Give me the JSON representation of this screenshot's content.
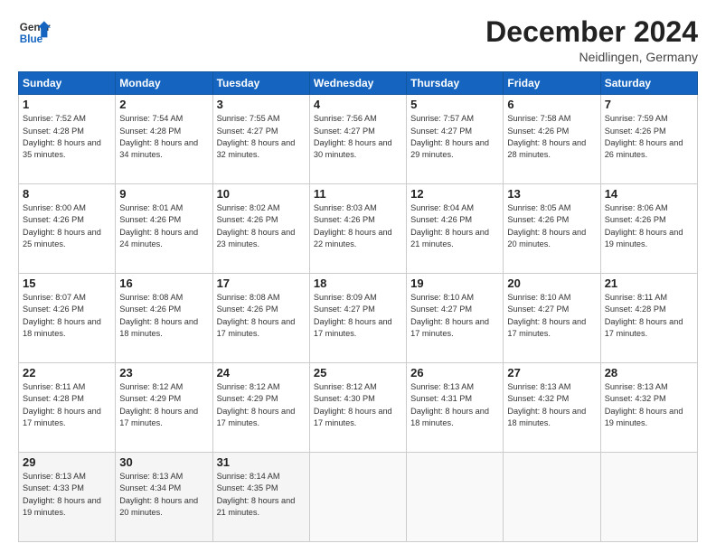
{
  "header": {
    "logo_line1": "General",
    "logo_line2": "Blue",
    "month": "December 2024",
    "location": "Neidlingen, Germany"
  },
  "weekdays": [
    "Sunday",
    "Monday",
    "Tuesday",
    "Wednesday",
    "Thursday",
    "Friday",
    "Saturday"
  ],
  "weeks": [
    [
      {
        "day": "1",
        "sunrise": "7:52 AM",
        "sunset": "4:28 PM",
        "daylight": "8 hours and 35 minutes."
      },
      {
        "day": "2",
        "sunrise": "7:54 AM",
        "sunset": "4:28 PM",
        "daylight": "8 hours and 34 minutes."
      },
      {
        "day": "3",
        "sunrise": "7:55 AM",
        "sunset": "4:27 PM",
        "daylight": "8 hours and 32 minutes."
      },
      {
        "day": "4",
        "sunrise": "7:56 AM",
        "sunset": "4:27 PM",
        "daylight": "8 hours and 30 minutes."
      },
      {
        "day": "5",
        "sunrise": "7:57 AM",
        "sunset": "4:27 PM",
        "daylight": "8 hours and 29 minutes."
      },
      {
        "day": "6",
        "sunrise": "7:58 AM",
        "sunset": "4:26 PM",
        "daylight": "8 hours and 28 minutes."
      },
      {
        "day": "7",
        "sunrise": "7:59 AM",
        "sunset": "4:26 PM",
        "daylight": "8 hours and 26 minutes."
      }
    ],
    [
      {
        "day": "8",
        "sunrise": "8:00 AM",
        "sunset": "4:26 PM",
        "daylight": "8 hours and 25 minutes."
      },
      {
        "day": "9",
        "sunrise": "8:01 AM",
        "sunset": "4:26 PM",
        "daylight": "8 hours and 24 minutes."
      },
      {
        "day": "10",
        "sunrise": "8:02 AM",
        "sunset": "4:26 PM",
        "daylight": "8 hours and 23 minutes."
      },
      {
        "day": "11",
        "sunrise": "8:03 AM",
        "sunset": "4:26 PM",
        "daylight": "8 hours and 22 minutes."
      },
      {
        "day": "12",
        "sunrise": "8:04 AM",
        "sunset": "4:26 PM",
        "daylight": "8 hours and 21 minutes."
      },
      {
        "day": "13",
        "sunrise": "8:05 AM",
        "sunset": "4:26 PM",
        "daylight": "8 hours and 20 minutes."
      },
      {
        "day": "14",
        "sunrise": "8:06 AM",
        "sunset": "4:26 PM",
        "daylight": "8 hours and 19 minutes."
      }
    ],
    [
      {
        "day": "15",
        "sunrise": "8:07 AM",
        "sunset": "4:26 PM",
        "daylight": "8 hours and 18 minutes."
      },
      {
        "day": "16",
        "sunrise": "8:08 AM",
        "sunset": "4:26 PM",
        "daylight": "8 hours and 18 minutes."
      },
      {
        "day": "17",
        "sunrise": "8:08 AM",
        "sunset": "4:26 PM",
        "daylight": "8 hours and 17 minutes."
      },
      {
        "day": "18",
        "sunrise": "8:09 AM",
        "sunset": "4:27 PM",
        "daylight": "8 hours and 17 minutes."
      },
      {
        "day": "19",
        "sunrise": "8:10 AM",
        "sunset": "4:27 PM",
        "daylight": "8 hours and 17 minutes."
      },
      {
        "day": "20",
        "sunrise": "8:10 AM",
        "sunset": "4:27 PM",
        "daylight": "8 hours and 17 minutes."
      },
      {
        "day": "21",
        "sunrise": "8:11 AM",
        "sunset": "4:28 PM",
        "daylight": "8 hours and 17 minutes."
      }
    ],
    [
      {
        "day": "22",
        "sunrise": "8:11 AM",
        "sunset": "4:28 PM",
        "daylight": "8 hours and 17 minutes."
      },
      {
        "day": "23",
        "sunrise": "8:12 AM",
        "sunset": "4:29 PM",
        "daylight": "8 hours and 17 minutes."
      },
      {
        "day": "24",
        "sunrise": "8:12 AM",
        "sunset": "4:29 PM",
        "daylight": "8 hours and 17 minutes."
      },
      {
        "day": "25",
        "sunrise": "8:12 AM",
        "sunset": "4:30 PM",
        "daylight": "8 hours and 17 minutes."
      },
      {
        "day": "26",
        "sunrise": "8:13 AM",
        "sunset": "4:31 PM",
        "daylight": "8 hours and 18 minutes."
      },
      {
        "day": "27",
        "sunrise": "8:13 AM",
        "sunset": "4:32 PM",
        "daylight": "8 hours and 18 minutes."
      },
      {
        "day": "28",
        "sunrise": "8:13 AM",
        "sunset": "4:32 PM",
        "daylight": "8 hours and 19 minutes."
      }
    ],
    [
      {
        "day": "29",
        "sunrise": "8:13 AM",
        "sunset": "4:33 PM",
        "daylight": "8 hours and 19 minutes."
      },
      {
        "day": "30",
        "sunrise": "8:13 AM",
        "sunset": "4:34 PM",
        "daylight": "8 hours and 20 minutes."
      },
      {
        "day": "31",
        "sunrise": "8:14 AM",
        "sunset": "4:35 PM",
        "daylight": "8 hours and 21 minutes."
      },
      null,
      null,
      null,
      null
    ]
  ],
  "labels": {
    "sunrise": "Sunrise:",
    "sunset": "Sunset:",
    "daylight": "Daylight:"
  }
}
